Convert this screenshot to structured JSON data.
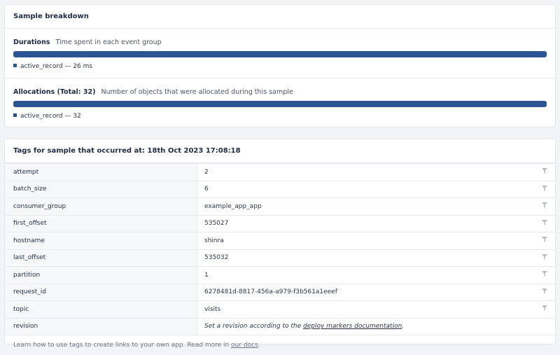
{
  "breakdown": {
    "title": "Sample breakdown",
    "durations": {
      "label": "Durations",
      "description": "Time spent in each event group",
      "legend": "active_record — 26 ms",
      "color": "#2b5592"
    },
    "allocations": {
      "label": "Allocations (Total: 32)",
      "description": "Number of objects that were allocated during this sample",
      "legend": "active_record — 32",
      "color": "#2b5592"
    }
  },
  "tags": {
    "title": "Tags for sample that occurred at: 18th Oct 2023 17:08:18",
    "rows": [
      {
        "key": "attempt",
        "value": "2"
      },
      {
        "key": "batch_size",
        "value": "6"
      },
      {
        "key": "consumer_group",
        "value": "example_app_app"
      },
      {
        "key": "first_offset",
        "value": "535027"
      },
      {
        "key": "hostname",
        "value": "shinra"
      },
      {
        "key": "last_offset",
        "value": "535032"
      },
      {
        "key": "partition",
        "value": "1"
      },
      {
        "key": "request_id",
        "value": "6278481d-8817-456a-a979-f3b561a1eeef"
      },
      {
        "key": "topic",
        "value": "visits"
      }
    ],
    "revision": {
      "key": "revision",
      "prefix": "Set a revision according to the ",
      "link": "deploy markers documentation",
      "suffix": "."
    },
    "footer": {
      "text": "Learn how to use tags to create links to your own app. Read more in ",
      "link": "our docs",
      "suffix": "."
    }
  }
}
